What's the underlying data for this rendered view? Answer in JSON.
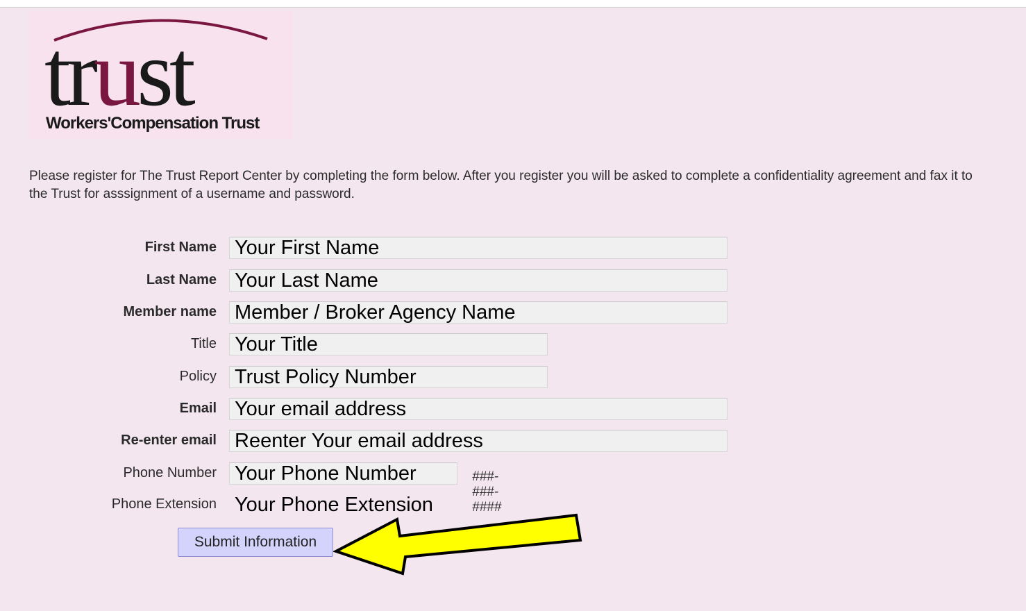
{
  "logo": {
    "wordmark": "trust",
    "tagline": "Workers'Compensation Trust"
  },
  "intro_text": "Please register for The Trust Report Center by completing the form below. After you register you will be asked to complete a confidentiality agreement and fax it to the Trust for asssignment of a username and password.",
  "form": {
    "first_name": {
      "label": "First Name",
      "placeholder": "Your First Name",
      "value": ""
    },
    "last_name": {
      "label": "Last Name",
      "placeholder": "Your Last Name",
      "value": ""
    },
    "member_name": {
      "label": "Member name",
      "placeholder": "Member / Broker Agency Name",
      "value": ""
    },
    "title": {
      "label": "Title",
      "placeholder": "Your Title",
      "value": ""
    },
    "policy": {
      "label": "Policy",
      "placeholder": "Trust Policy Number",
      "value": ""
    },
    "email": {
      "label": "Email",
      "placeholder": "Your email address",
      "value": ""
    },
    "reenter_email": {
      "label": "Re-enter email",
      "placeholder": "Reenter Your email address",
      "value": ""
    },
    "phone_number": {
      "label": "Phone Number",
      "placeholder": "Your Phone Number",
      "value": "",
      "format_hint": "###-###-####"
    },
    "phone_extension": {
      "label": "Phone Extension",
      "placeholder": "Your Phone Extension",
      "value": ""
    },
    "submit_label": "Submit Information"
  },
  "colors": {
    "page_background": "#f3e6ee",
    "logo_text": "#1a1a1a",
    "logo_accent": "#7a1740",
    "button_background": "#d3d3fb",
    "arrow_fill": "#ffff00"
  },
  "icons": {
    "annotation_arrow": "left-arrow-icon"
  }
}
